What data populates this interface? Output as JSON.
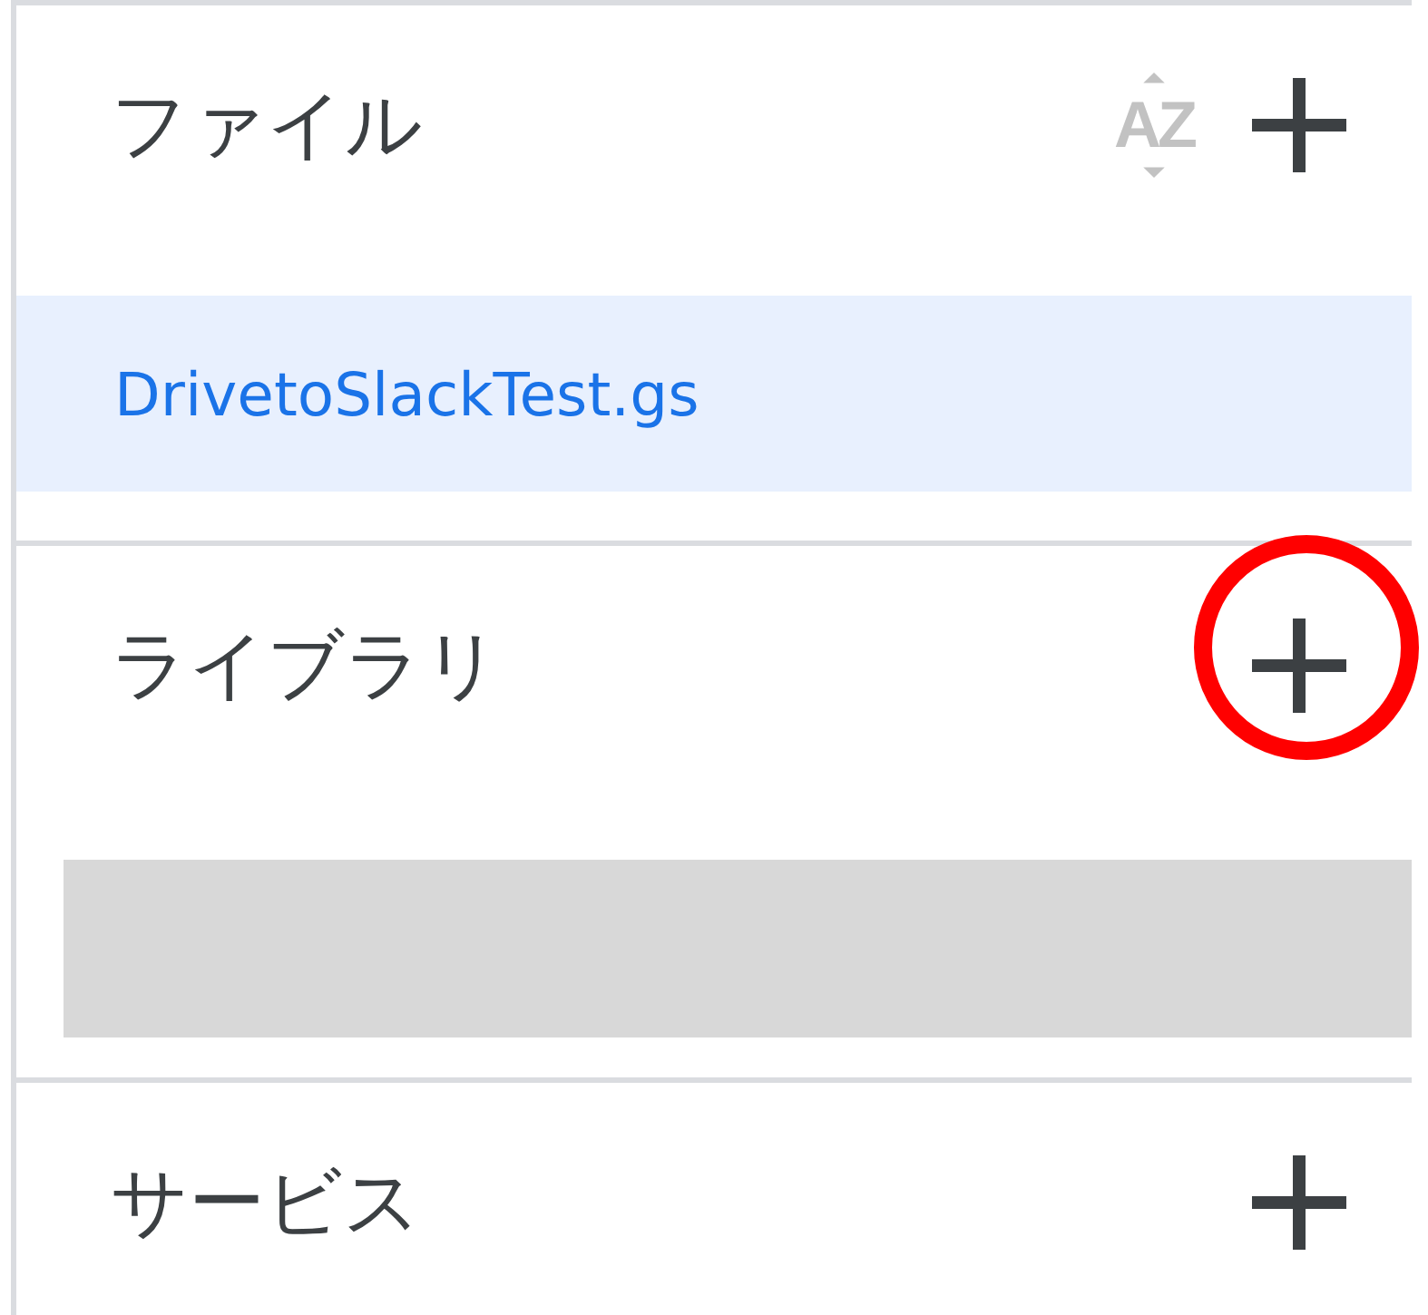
{
  "sections": [
    {
      "title": "ファイル",
      "sort_label": "AZ",
      "annotated": false,
      "kind": "files",
      "items": [
        {
          "name": "DrivetoSlackTest.gs",
          "selected": true
        }
      ]
    },
    {
      "title": "ライブラリ",
      "annotated": true,
      "kind": "loading"
    },
    {
      "title": "サービス",
      "annotated": false,
      "kind": "none"
    }
  ]
}
